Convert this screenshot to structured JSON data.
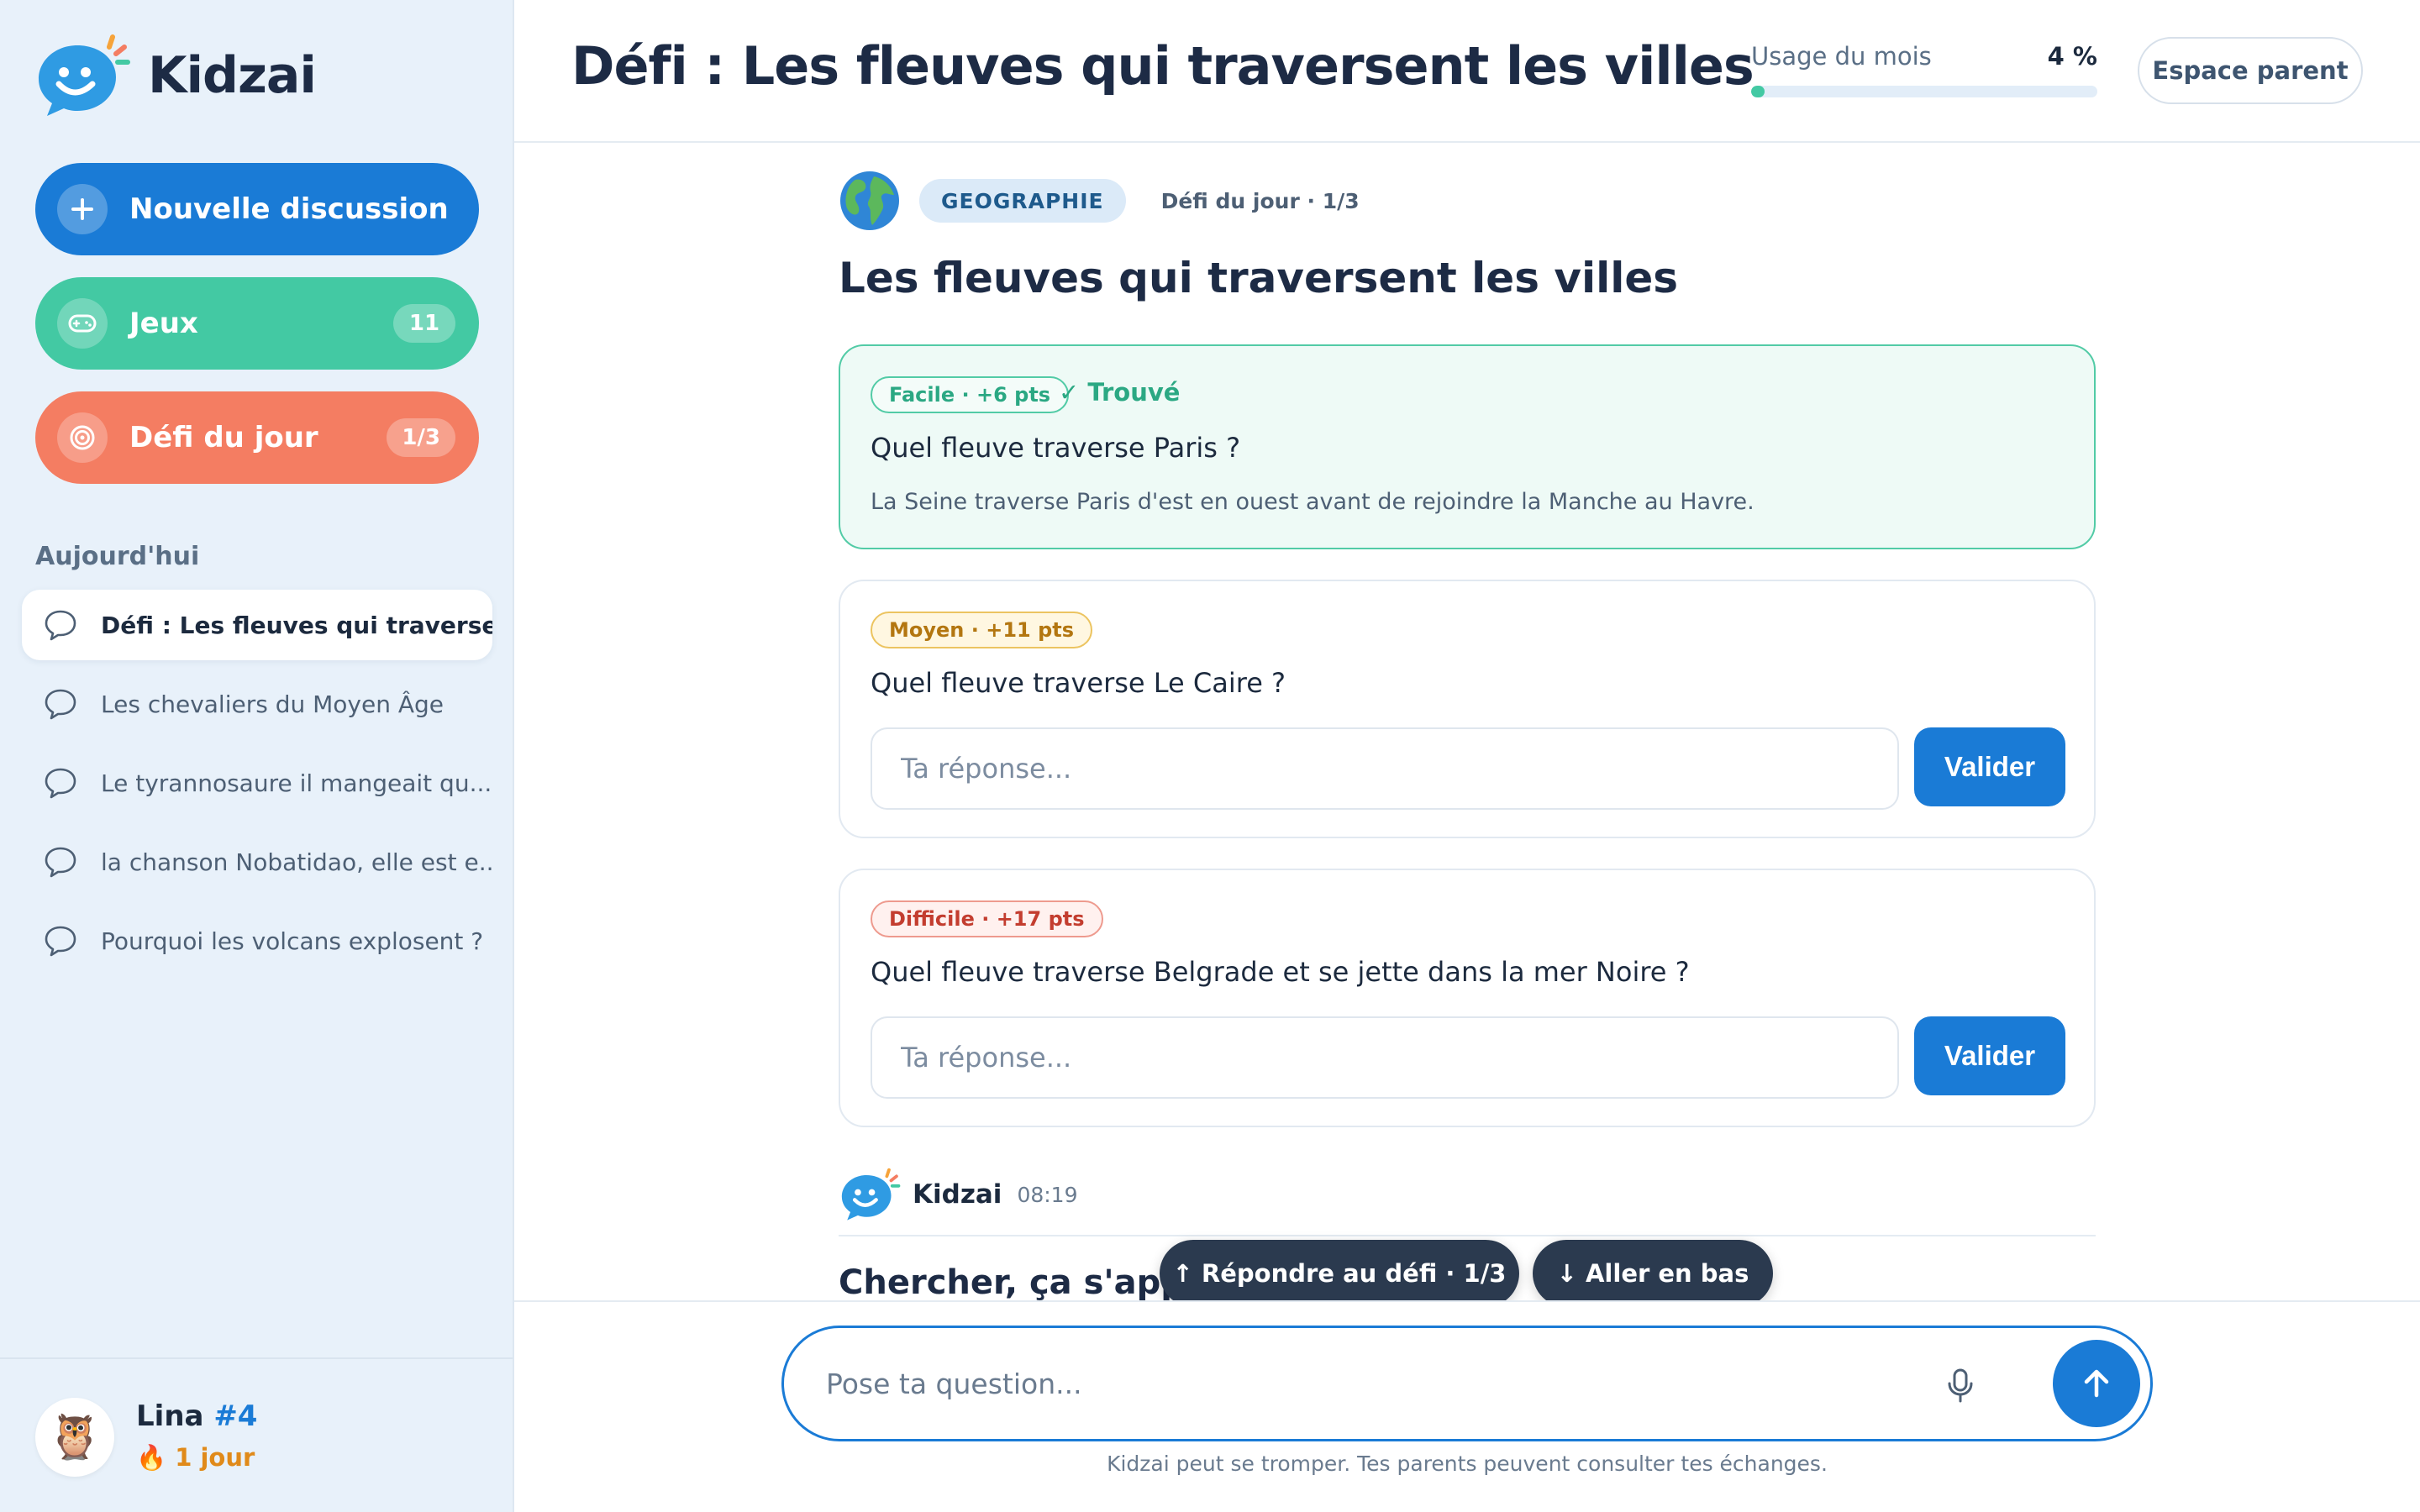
{
  "app": {
    "name": "Kidzai"
  },
  "sidebar": {
    "new_chat": {
      "label": "Nouvelle discussion"
    },
    "games": {
      "label": "Jeux",
      "badge": "11"
    },
    "daily": {
      "label": "Défi du jour",
      "badge": "1/3"
    },
    "section_title": "Aujourd'hui",
    "conversations": [
      {
        "title": "Défi : Les fleuves qui traverse...",
        "active": true
      },
      {
        "title": "Les chevaliers du Moyen Âge",
        "active": false
      },
      {
        "title": "Le tyrannosaure il mangeait qu...",
        "active": false
      },
      {
        "title": "la chanson Nobatidao, elle est e...",
        "active": false
      },
      {
        "title": "Pourquoi les volcans explosent ?",
        "active": false
      }
    ],
    "user": {
      "name": "Lina",
      "rank": "#4",
      "streak": "🔥 1 jour",
      "avatar": "🦉"
    }
  },
  "header": {
    "title": "Défi : Les fleuves qui traversent les villes",
    "usage": {
      "label": "Usage du mois",
      "value_text": "4 %",
      "fraction": 0.04
    },
    "parent_button": "Espace parent"
  },
  "challenge": {
    "topic_icon": "globe-icon",
    "topic": "GEOGRAPHIE",
    "meta": "Défi du jour · 1/3",
    "title": "Les fleuves qui traversent les villes",
    "questions": [
      {
        "difficulty": "Facile · +6 pts",
        "status": "✓ Trouvé",
        "question": "Quel fleuve traverse Paris ?",
        "answer": "La Seine traverse Paris d'est en ouest avant de rejoindre la Manche au Havre."
      },
      {
        "difficulty": "Moyen · +11 pts",
        "question": "Quel fleuve traverse Le Caire ?",
        "placeholder": "Ta réponse...",
        "button": "Valider"
      },
      {
        "difficulty": "Difficile · +17 pts",
        "question": "Quel fleuve traverse Belgrade et se jette dans la mer Noire ?",
        "placeholder": "Ta réponse...",
        "button": "Valider"
      }
    ]
  },
  "bot_message": {
    "name": "Kidzai",
    "time": "08:19",
    "text": "Chercher, ça s'appre"
  },
  "floating": {
    "answer_challenge": "↑ Répondre au défi · 1/3",
    "go_bottom": "↓ Aller en bas"
  },
  "composer": {
    "placeholder": "Pose ta question...",
    "disclaimer": "Kidzai peut se tromper. Tes parents peuvent consulter tes échanges."
  },
  "colors": {
    "primary": "#1a7bd6",
    "games": "#43c9a3",
    "daily": "#f47d62",
    "sidebar_bg": "#e8f1fa"
  }
}
